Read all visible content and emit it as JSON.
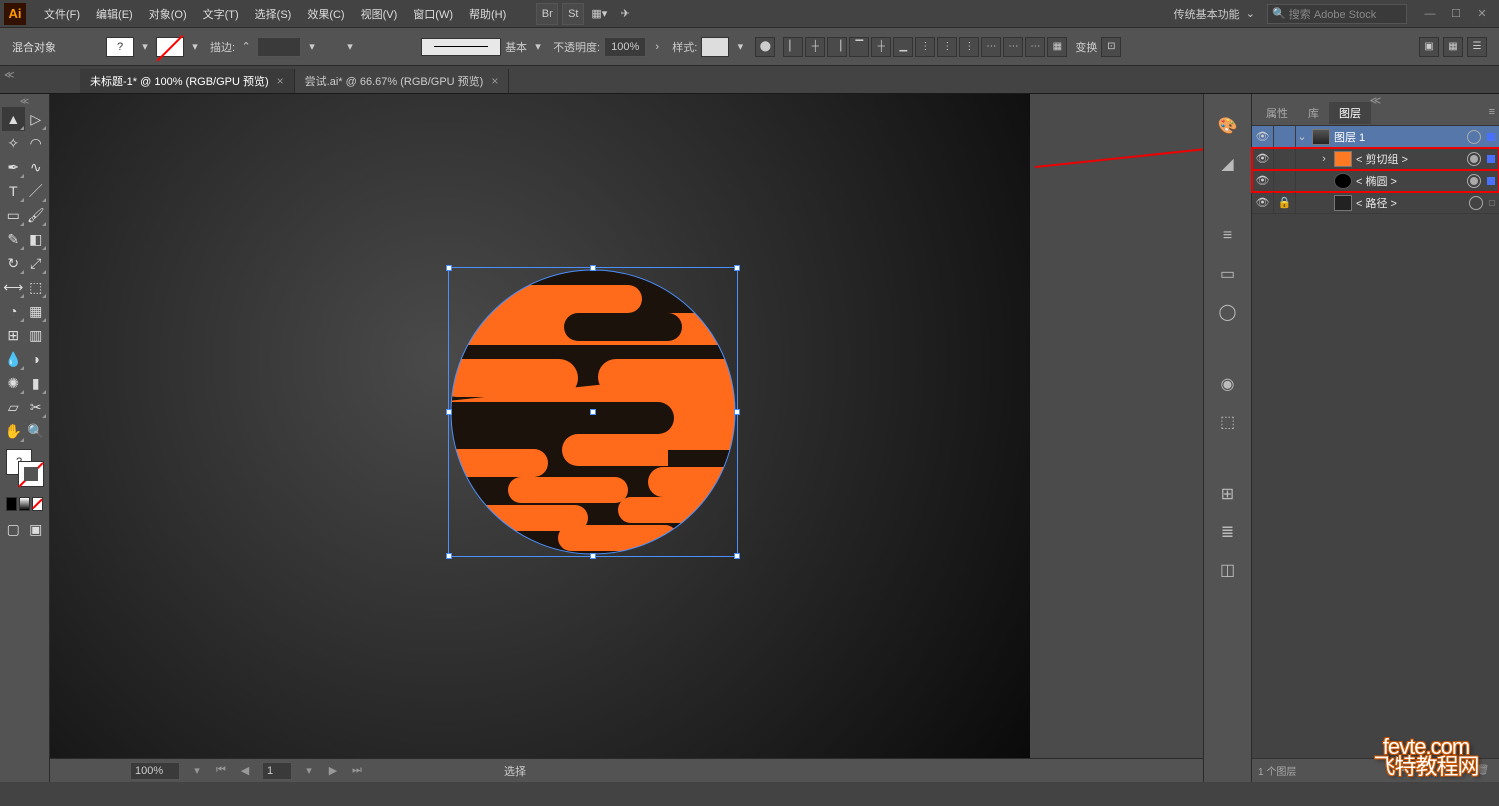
{
  "app": {
    "logo": "Ai"
  },
  "menu": {
    "file": "文件(F)",
    "edit": "编辑(E)",
    "object": "对象(O)",
    "type": "文字(T)",
    "select": "选择(S)",
    "effect": "效果(C)",
    "view": "视图(V)",
    "window": "窗口(W)",
    "help": "帮助(H)"
  },
  "workspace": {
    "label": "传统基本功能"
  },
  "search": {
    "placeholder": "搜索 Adobe Stock"
  },
  "control": {
    "mode": "混合对象",
    "stroke_label": "描边:",
    "basic_label": "基本",
    "opacity_label": "不透明度:",
    "opacity_value": "100%",
    "style_label": "样式:",
    "transform_label": "变换"
  },
  "tabs": {
    "t1": "未标题-1* @ 100% (RGB/GPU 预览)",
    "t2": "尝试.ai* @ 66.67% (RGB/GPU 预览)"
  },
  "status": {
    "zoom": "100%",
    "page": "1",
    "select": "选择"
  },
  "panels": {
    "tab_props": "属性",
    "tab_lib": "库",
    "tab_layers": "图层",
    "layer1": "图层 1",
    "clip": "< 剪切组 >",
    "ellipse": "< 椭圆 >",
    "path": "< 路径 >",
    "footer": "1 个图层"
  },
  "watermark": {
    "line1": "fevte.com",
    "line2": "飞特教程网"
  }
}
